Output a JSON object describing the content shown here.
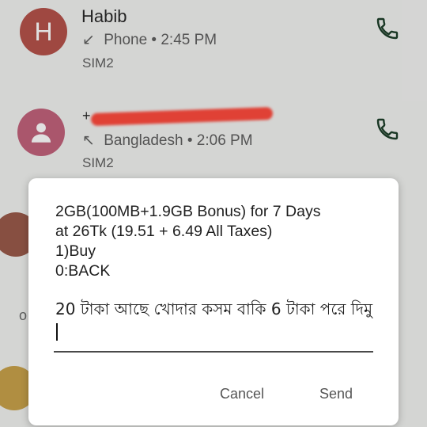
{
  "call_log": [
    {
      "name": "Habib",
      "avatar_letter": "H",
      "avatar_color": "#b5524a",
      "direction_icon": "↙",
      "detail": "Phone • 2:45 PM",
      "sim": "SIM2"
    },
    {
      "name_prefix": "+",
      "avatar_color": "#c2627b",
      "direction_icon": "↖",
      "detail": "Bangladesh • 2:06 PM",
      "sim": "SIM2"
    }
  ],
  "partial_rows": {
    "left_letter": "o"
  },
  "dialog": {
    "message": "2GB(100MB+1.9GB Bonus) for 7 Days\nat 26Tk (19.51 + 6.49 All Taxes)\n1)Buy\n0:BACK",
    "reply_value": "20 টাকা আছে খোদার কসম বাকি 6 টাকা পরে দিমু",
    "cancel_label": "Cancel",
    "send_label": "Send"
  },
  "colors": {
    "background": "#f2f3f1",
    "redaction": "#ff4a3d",
    "accent_text": "#555555"
  }
}
